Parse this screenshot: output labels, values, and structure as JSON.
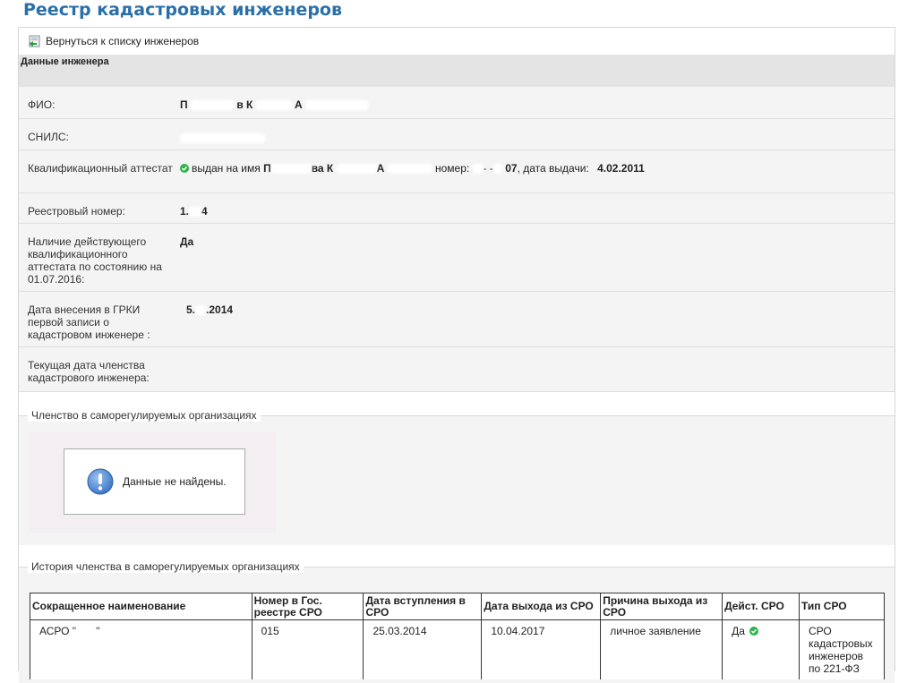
{
  "page": {
    "title": "Реестр кадастровых инженеров"
  },
  "nav": {
    "back_label": "Вернуться к списку инженеров"
  },
  "section": {
    "title": "Данные инженера"
  },
  "engineer": {
    "fio_label": "ФИО:",
    "fio_parts": [
      "П",
      "в К",
      "А"
    ],
    "snils_label": "СНИЛС:",
    "attest_label": "Квалификационный аттестат",
    "attest_issued_to": "выдан на имя",
    "attest_name_parts": [
      "П",
      "ва К",
      "А"
    ],
    "attest_number_label": "номер:",
    "attest_number_parts": [
      "-",
      "-",
      "07"
    ],
    "attest_date_label": ", дата выдачи:",
    "attest_date": "4.02.2011",
    "reg_number_label": "Реестровый номер:",
    "reg_number_parts": [
      "1.",
      "4"
    ],
    "valid_label": "Наличие действующего квалификационного аттестата по состоянию на 01.07.2016:",
    "valid_value": "Да",
    "grki_label": "Дата внесения в ГРКИ первой записи о кадастровом инженере :",
    "grki_parts": [
      "5.",
      ".2014"
    ],
    "membership_date_label": "Текущая дата членства кадастрового инженера:"
  },
  "membership": {
    "legend": "Членство в саморегулируемых организациях",
    "empty_message": "Данные не найдены."
  },
  "history": {
    "legend": "История членства в саморегулируемых организациях",
    "columns": [
      "Сокращенное наименование",
      "Номер в Гос. реестре СРО",
      "Дата вступления в СРО",
      "Дата выхода из СРО",
      "Причина выхода из СРО",
      "Дейст. СРО",
      "Тип СРО"
    ],
    "rows": [
      {
        "name_parts": [
          "АСРО \"",
          "\""
        ],
        "number": "015",
        "join_date": "25.03.2014",
        "exit_date": "10.04.2017",
        "exit_reason": "личное заявление",
        "active": "Да",
        "type": "СРО кадастровых инженеров по 221-ФЗ"
      }
    ]
  },
  "colors": {
    "title": "#2a6fa8",
    "ok": "#2db34a",
    "warn": "#3e78c8",
    "row_bg": "#f4f4f4",
    "header_bg": "#e4e4e4"
  }
}
